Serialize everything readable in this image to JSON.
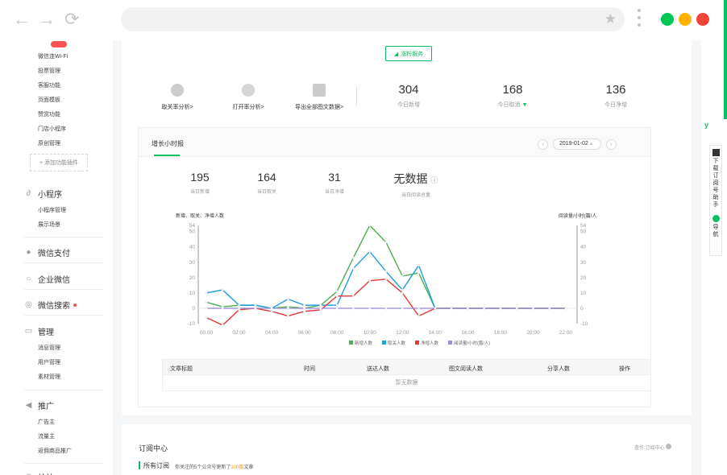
{
  "browser": {
    "back_icon": "arrow-left-icon",
    "forward_icon": "arrow-right-icon",
    "reload_icon": "reload-icon",
    "dot_colors": [
      "#00c853",
      "#ffb300",
      "#f44336"
    ]
  },
  "sidebar": {
    "top_items": [
      "微信连Wi-Fi",
      "投票管理",
      "客服功能",
      "页面模板",
      "赞赏功能",
      "门店小程序",
      "原创管理"
    ],
    "add_plugin": "+ 添加功能插件",
    "mini_program": {
      "label": "小程序",
      "items": [
        "小程序管理",
        "展示场景"
      ]
    },
    "wechat_pay": "微信支付",
    "enterprise_wechat": "企业微信",
    "wechat_search": "微信搜索",
    "manage": {
      "label": "管理",
      "items": [
        "消息管理",
        "用户管理",
        "素材管理"
      ]
    },
    "promote": {
      "label": "推广",
      "items": [
        "广告主",
        "流量主",
        "返佣商品推广"
      ]
    },
    "stats": "统计"
  },
  "header": {
    "promo_button": "涨粉服务",
    "tools": [
      "取关率分析>",
      "打开率分析>",
      "导出全部图文数据>"
    ],
    "stats": [
      {
        "value": "304",
        "label": "今日新增"
      },
      {
        "value": "168",
        "label": "今日取消"
      },
      {
        "value": "136",
        "label": "今日净增"
      }
    ]
  },
  "growth": {
    "title": "增长小时报",
    "date": "2019-01-02",
    "prev": "‹",
    "next": "›",
    "stats": [
      {
        "value": "195",
        "label": "当日新增"
      },
      {
        "value": "164",
        "label": "当日取关"
      },
      {
        "value": "31",
        "label": "当日净增"
      },
      {
        "value": "无数据",
        "label": "当日阅读总量"
      }
    ]
  },
  "chart_data": {
    "type": "line",
    "ylabel_left": "新增、取关、净增人数",
    "ylabel_right": "阅读量/小时(篇/人",
    "x": [
      "00:00",
      "01:00",
      "02:00",
      "03:00",
      "04:00",
      "05:00",
      "06:00",
      "07:00",
      "08:00",
      "09:00",
      "10:00",
      "11:00",
      "12:00",
      "13:00",
      "14:00",
      "15:00",
      "16:00",
      "17:00",
      "18:00",
      "19:00",
      "20:00",
      "21:00",
      "22:00"
    ],
    "x_tick_labels": [
      "00:00",
      "02:00",
      "04:00",
      "06:00",
      "08:00",
      "10:00",
      "12:00",
      "14:00",
      "16:00",
      "18:00",
      "20:00",
      "22:00"
    ],
    "y_ticks": [
      -10,
      0,
      10,
      20,
      30,
      40,
      50,
      54
    ],
    "ylim": [
      -10,
      54
    ],
    "series": [
      {
        "name": "新增人数",
        "color": "#4caf50",
        "values": [
          4,
          1,
          2,
          2,
          0,
          1,
          0,
          2,
          11,
          33,
          54,
          43,
          21,
          23,
          0,
          0,
          0,
          0,
          0,
          0,
          0,
          0,
          0
        ]
      },
      {
        "name": "取关人数",
        "color": "#1ea0dc",
        "values": [
          10,
          12,
          2,
          2,
          0,
          6,
          2,
          2,
          2,
          26,
          37,
          24,
          12,
          28,
          0,
          0,
          0,
          0,
          0,
          0,
          0,
          0,
          0
        ]
      },
      {
        "name": "净增人数",
        "color": "#e53935",
        "values": [
          -6,
          -11,
          -1,
          0,
          -2,
          -5,
          -2,
          -1,
          8,
          8,
          18,
          19,
          10,
          -5,
          0,
          0,
          0,
          0,
          0,
          0,
          0,
          0,
          0
        ]
      },
      {
        "name": "阅读量/小时(篇/人)",
        "color": "#9b8fd6",
        "values": [
          0,
          0,
          0,
          0,
          0,
          0,
          0,
          0,
          0,
          0,
          0,
          0,
          0,
          0,
          0,
          0,
          0,
          0,
          0,
          0,
          0,
          0,
          0
        ]
      }
    ]
  },
  "table": {
    "headers": [
      "文章标题",
      "时间",
      "送达人数",
      "图文阅读人数",
      "分享人数",
      "操作"
    ],
    "empty_text": "暂无数据"
  },
  "subscribe": {
    "title": "订阅中心",
    "link": "查作:订阅中心",
    "all_label": "所有订阅",
    "note_prefix": "你关注的5个公众号更新了",
    "note_count": "100篇",
    "note_suffix": "文章"
  },
  "right_panel": {
    "download": "下载订阅号助手",
    "nav": "导航"
  }
}
